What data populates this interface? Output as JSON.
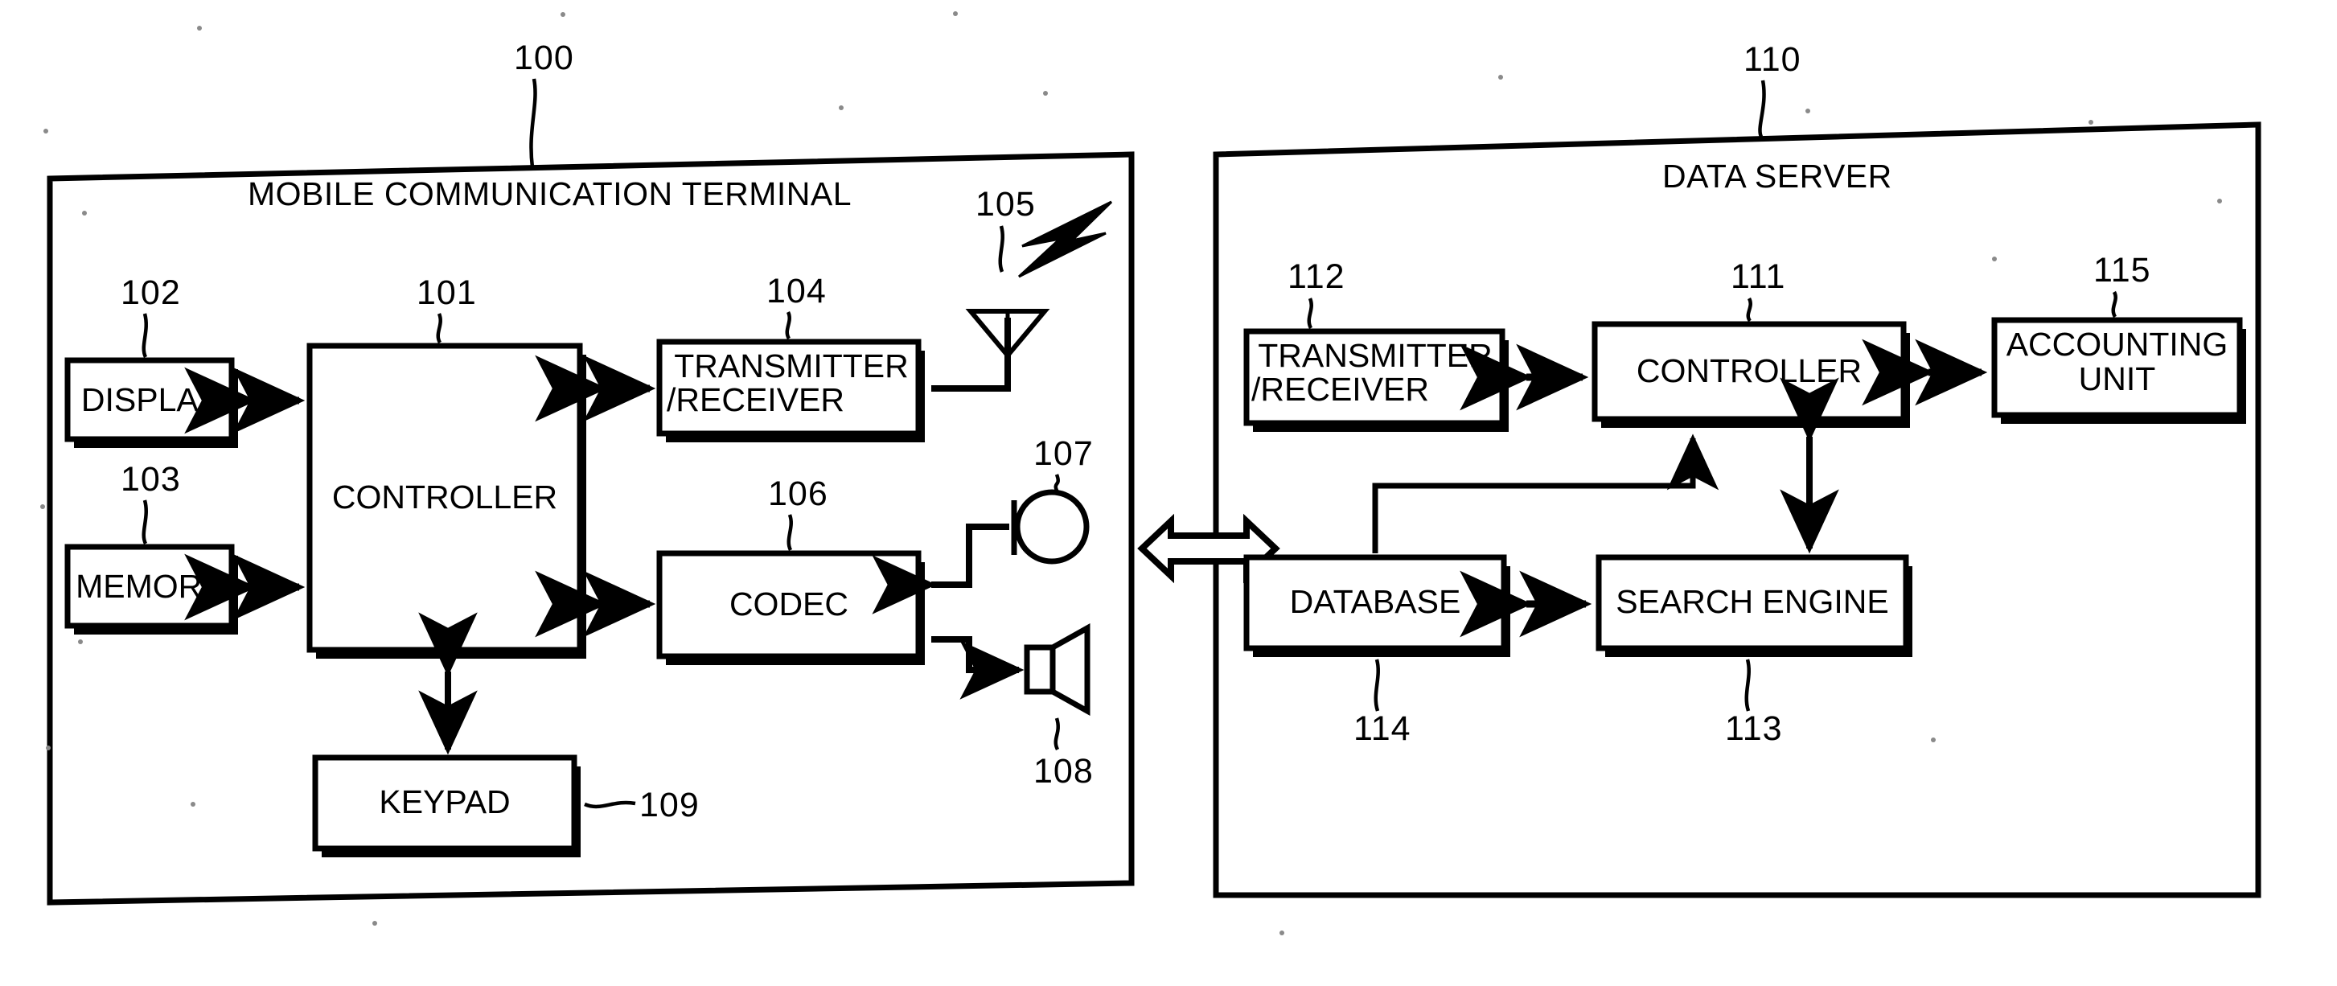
{
  "figure": {
    "type": "patent-block-diagram",
    "panels": [
      {
        "id": "terminal",
        "title": "MOBILE COMMUNICATION TERMINAL",
        "ref": "100"
      },
      {
        "id": "server",
        "title": "DATA SERVER",
        "ref": "110"
      }
    ],
    "blocks": [
      {
        "id": "display",
        "label": "DISPLAY",
        "ref": "102",
        "panel": "terminal"
      },
      {
        "id": "memory",
        "label": "MEMORY",
        "ref": "103",
        "panel": "terminal"
      },
      {
        "id": "controller",
        "label": "CONTROLLER",
        "ref": "101",
        "panel": "terminal"
      },
      {
        "id": "transceiver",
        "label_line1": "TRANSMITTER",
        "label_line2": "/RECEIVER",
        "ref": "104",
        "panel": "terminal"
      },
      {
        "id": "antenna",
        "label": "",
        "ref": "105",
        "panel": "terminal"
      },
      {
        "id": "codec",
        "label": "CODEC",
        "ref": "106",
        "panel": "terminal"
      },
      {
        "id": "microphone",
        "label": "",
        "ref": "107",
        "panel": "terminal"
      },
      {
        "id": "speaker",
        "label": "",
        "ref": "108",
        "panel": "terminal"
      },
      {
        "id": "keypad",
        "label": "KEYPAD",
        "ref": "109",
        "panel": "terminal"
      },
      {
        "id": "srv-transceiver",
        "label_line1": "TRANSMITTER",
        "label_line2": "/RECEIVER",
        "ref": "112",
        "panel": "server"
      },
      {
        "id": "srv-controller",
        "label": "CONTROLLER",
        "ref": "111",
        "panel": "server"
      },
      {
        "id": "accounting",
        "label_line1": "ACCOUNTING",
        "label_line2": "UNIT",
        "ref": "115",
        "panel": "server"
      },
      {
        "id": "database",
        "label": "DATABASE",
        "ref": "114",
        "panel": "server"
      },
      {
        "id": "search-engine",
        "label": "SEARCH ENGINE",
        "ref": "113",
        "panel": "server"
      }
    ],
    "colors": {
      "line": "#000000",
      "background": "#ffffff",
      "shadow": "#000000"
    }
  }
}
